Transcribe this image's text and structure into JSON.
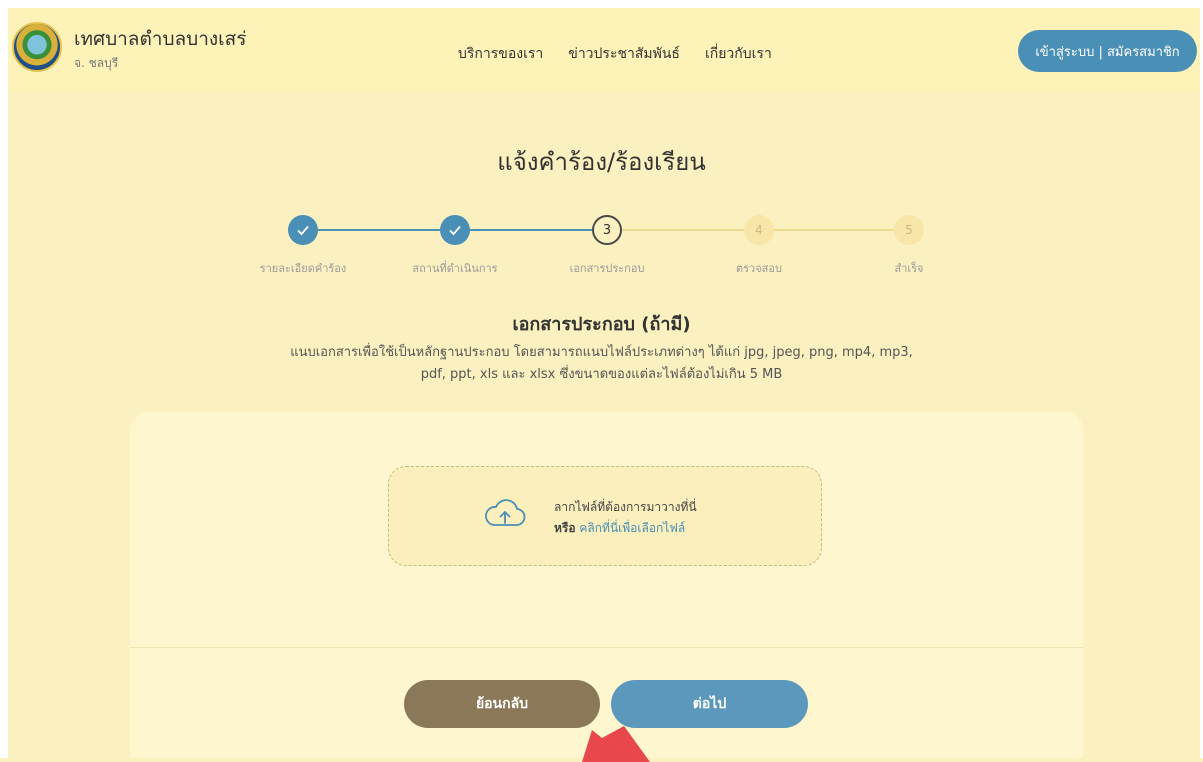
{
  "header": {
    "org_name": "เทศบาลตำบลบางเสร่",
    "province": "จ. ชลบุรี",
    "nav": [
      "บริการของเรา",
      "ข่าวประชาสัมพันธ์",
      "เกี่ยวกับเรา"
    ],
    "login_label": "เข้าสู่ระบบ | สมัครสมาชิก"
  },
  "page_title": "แจ้งคำร้อง/ร้องเรียน",
  "stepper": {
    "steps": [
      {
        "number": "1",
        "label": "รายละเอียดคำร้อง",
        "status": "done"
      },
      {
        "number": "2",
        "label": "สถานที่ดำเนินการ",
        "status": "done"
      },
      {
        "number": "3",
        "label": "เอกสารประกอบ",
        "status": "current"
      },
      {
        "number": "4",
        "label": "ตรวจสอบ",
        "status": "pending"
      },
      {
        "number": "5",
        "label": "สำเร็จ",
        "status": "pending"
      }
    ]
  },
  "section": {
    "title": "เอกสารประกอบ (ถ้ามี)",
    "desc_line1": "แนบเอกสารเพื่อใช้เป็นหลักฐานประกอบ โดยสามารถแนบไฟล์ประเภทต่างๆ ได้แก่ jpg, jpeg, png, mp4, mp3,",
    "desc_line2": "pdf, ppt, xls และ xlsx ซึ่งขนาดของแต่ละไฟล์ต้องไม่เกิน 5 MB"
  },
  "dropzone": {
    "line1": "ลากไฟล์ที่ต้องการมาวางที่นี่",
    "or_label": "หรือ",
    "link_label": "คลิกที่นี่เพื่อเลือกไฟล์"
  },
  "buttons": {
    "back": "ย้อนกลับ",
    "next": "ต่อไป"
  },
  "colors": {
    "accent": "#4a8fb5",
    "back_button": "#8b7858",
    "background": "#fbf1c0"
  },
  "icons": {
    "step_done": "check-icon",
    "dropzone": "cloud-upload-icon"
  }
}
